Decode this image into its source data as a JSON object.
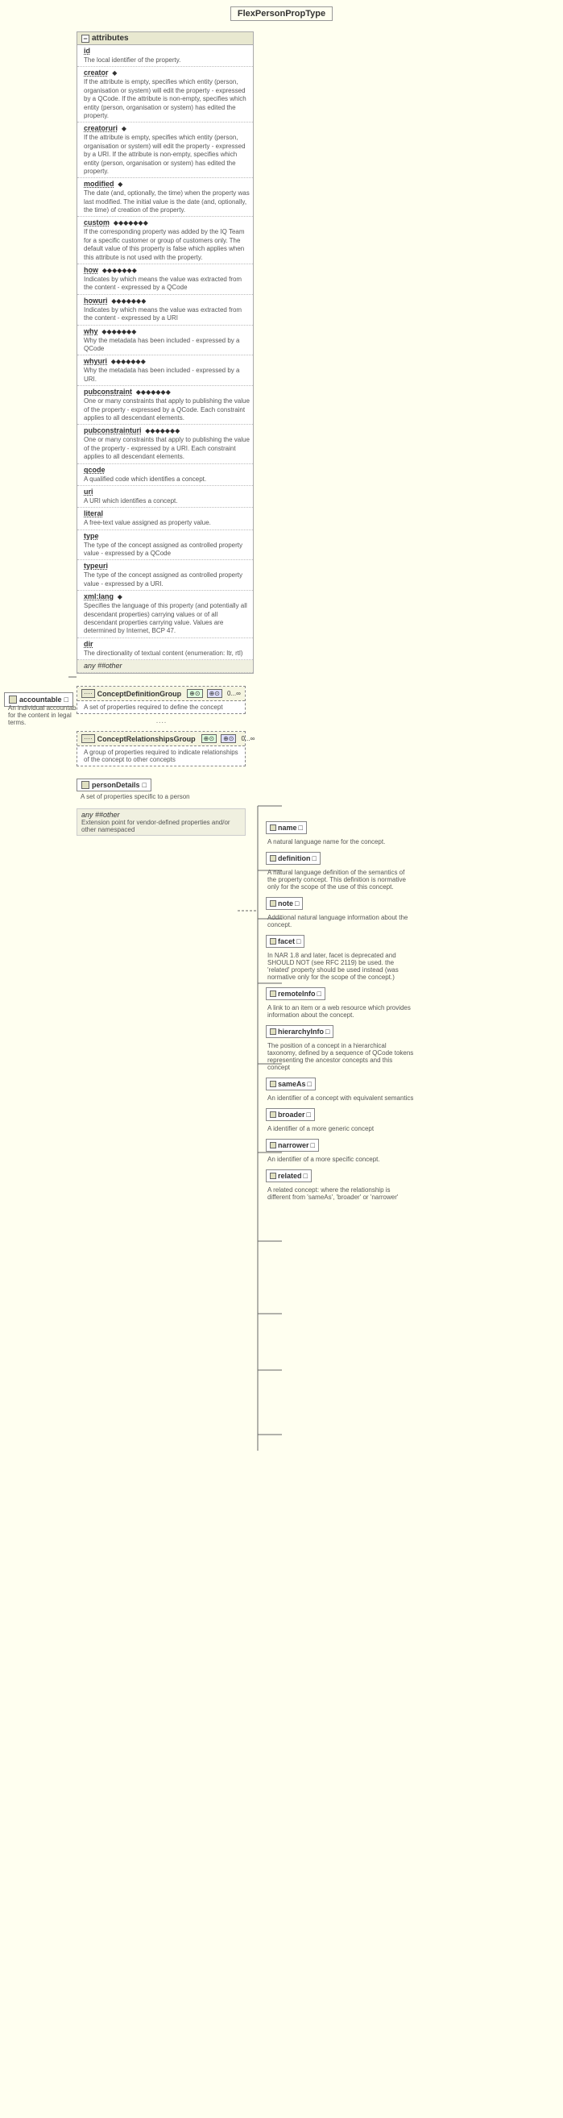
{
  "title": "FlexPersonPropType",
  "sections": {
    "attributes_header": "attributes",
    "attributes": [
      {
        "name": "id",
        "indicator": "",
        "desc": "The local identifier of the property."
      },
      {
        "name": "creator",
        "indicator": "◆",
        "desc": "If the attribute is empty, specifies which entity (person, organisation or system) will edit the property - expressed by a QCode. If the attribute is non-empty, specifies which entity (person, organisation or system) has edited the property."
      },
      {
        "name": "creatoruri",
        "indicator": "◆",
        "desc": "If the attribute is empty, specifies which entity (person, organisation or system) will edit the property - expressed by a URI. If the attribute is non-empty, specifies which entity (person, organisation or system) has edited the property."
      },
      {
        "name": "modified",
        "indicator": "◆",
        "desc": "The date (and, optionally, the time) when the property was last modified. The initial value is the date (and, optionally, the time) of creation of the property."
      },
      {
        "name": "custom",
        "indicator": "◆◆◆◆◆◆◆",
        "desc": "If the corresponding property was added by the IQ Team for a specific customer or group of customers only. The default value of this property is false which applies when this attribute is not used with the property."
      },
      {
        "name": "how",
        "indicator": "◆◆◆◆◆◆◆",
        "desc": "Indicates by which means the value was extracted from the content - expressed by a QCode"
      },
      {
        "name": "howuri",
        "indicator": "◆◆◆◆◆◆◆",
        "desc": "Indicates by which means the value was extracted from the content - expressed by a URI"
      },
      {
        "name": "why",
        "indicator": "◆◆◆◆◆◆◆",
        "desc": "Why the metadata has been included - expressed by a QCode"
      },
      {
        "name": "whyuri",
        "indicator": "◆◆◆◆◆◆◆",
        "desc": "Why the metadata has been included - expressed by a URI."
      },
      {
        "name": "pubconstraint",
        "indicator": "◆◆◆◆◆◆◆",
        "desc": "One or many constraints that apply to publishing the value of the property - expressed by a QCode. Each constraint applies to all descendant elements."
      },
      {
        "name": "pubconstrainturi",
        "indicator": "◆◆◆◆◆◆◆",
        "desc": "One or many constraints that apply to publishing the value of the property - expressed by a URI. Each constraint applies to all descendant elements."
      },
      {
        "name": "qcode",
        "indicator": "",
        "desc": "A qualified code which identifies a concept."
      },
      {
        "name": "uri",
        "indicator": "",
        "desc": "A URI which identifies a concept."
      },
      {
        "name": "literal",
        "indicator": "",
        "desc": "A free-text value assigned as property value."
      },
      {
        "name": "type",
        "indicator": "",
        "desc": "The type of the concept assigned as controlled property value - expressed by a QCode"
      },
      {
        "name": "typeuri",
        "indicator": "",
        "desc": "The type of the concept assigned as controlled property value - expressed by a URI."
      },
      {
        "name": "xmllang",
        "indicator": "◆",
        "desc": "Specifies the language of this property (and potentially all descendant properties) carrying values or of all descendant properties carrying value. Values are determined by Internet, BCP 47."
      }
    ]
  },
  "left_item": {
    "name": "accountable",
    "icon": "□",
    "desc": "An individual accountable for the content in legal terms."
  },
  "dir_item": {
    "name": "dir",
    "desc": "The directionality of textual content (enumeration: ltr, rtl)"
  },
  "any_other_bottom": "any ##other",
  "concept_definition_group": {
    "name": "ConceptDefinitionGroup",
    "desc": "A set of properties required to define the concept",
    "cardinality": "0...∞",
    "icon": "····",
    "items": [
      {
        "name": "name",
        "icon": "□",
        "desc": "A natural language name for the concept."
      },
      {
        "name": "definition",
        "icon": "□",
        "desc": "A natural language definition of the semantics of the property concept. This definition is normative only for the scope of the use of this concept."
      },
      {
        "name": "note",
        "icon": "□",
        "desc": "Additional natural language information about the concept."
      },
      {
        "name": "facet",
        "icon": "□",
        "desc": "In NAR 1.8 and later, facet is deprecated and SHOULD NOT (see RFC 2119) be used. the 'related' property should be used instead (was normative only for the scope of the concept.)"
      },
      {
        "name": "remoteInfo",
        "icon": "□",
        "desc": "A link to an item or a web resource which provides information about the concept."
      },
      {
        "name": "hierarchyInfo",
        "icon": "□",
        "desc": "The position of a concept in a hierarchical taxonomy, defined by a sequence of QCode tokens representing the ancestor concepts and this concept"
      },
      {
        "name": "sameAs",
        "icon": "□",
        "desc": "An identifier of a concept with equivalent semantics"
      },
      {
        "name": "broader",
        "icon": "□",
        "desc": "A identifier of a more generic concept"
      },
      {
        "name": "narrower",
        "icon": "□",
        "desc": "An identifier of a more specific concept."
      },
      {
        "name": "related",
        "icon": "□",
        "desc": "A related concept: where the relationship is different from 'sameAs', 'broader' or 'narrower'"
      }
    ]
  },
  "concept_relationships_group": {
    "name": "ConceptRelationshipsGroup",
    "desc": "A group of properties required to indicate relationships of the concept to other concepts",
    "cardinality": "0...∞",
    "icon": "····"
  },
  "person_details": {
    "name": "personDetails",
    "icon": "□",
    "desc": "A set of properties specific to a person"
  },
  "any_other_extension": "any ##other",
  "extension_desc": "Extension point for vendor-defined properties and/or other namespaced",
  "connector_dots": "····",
  "any_label": "any ##other"
}
